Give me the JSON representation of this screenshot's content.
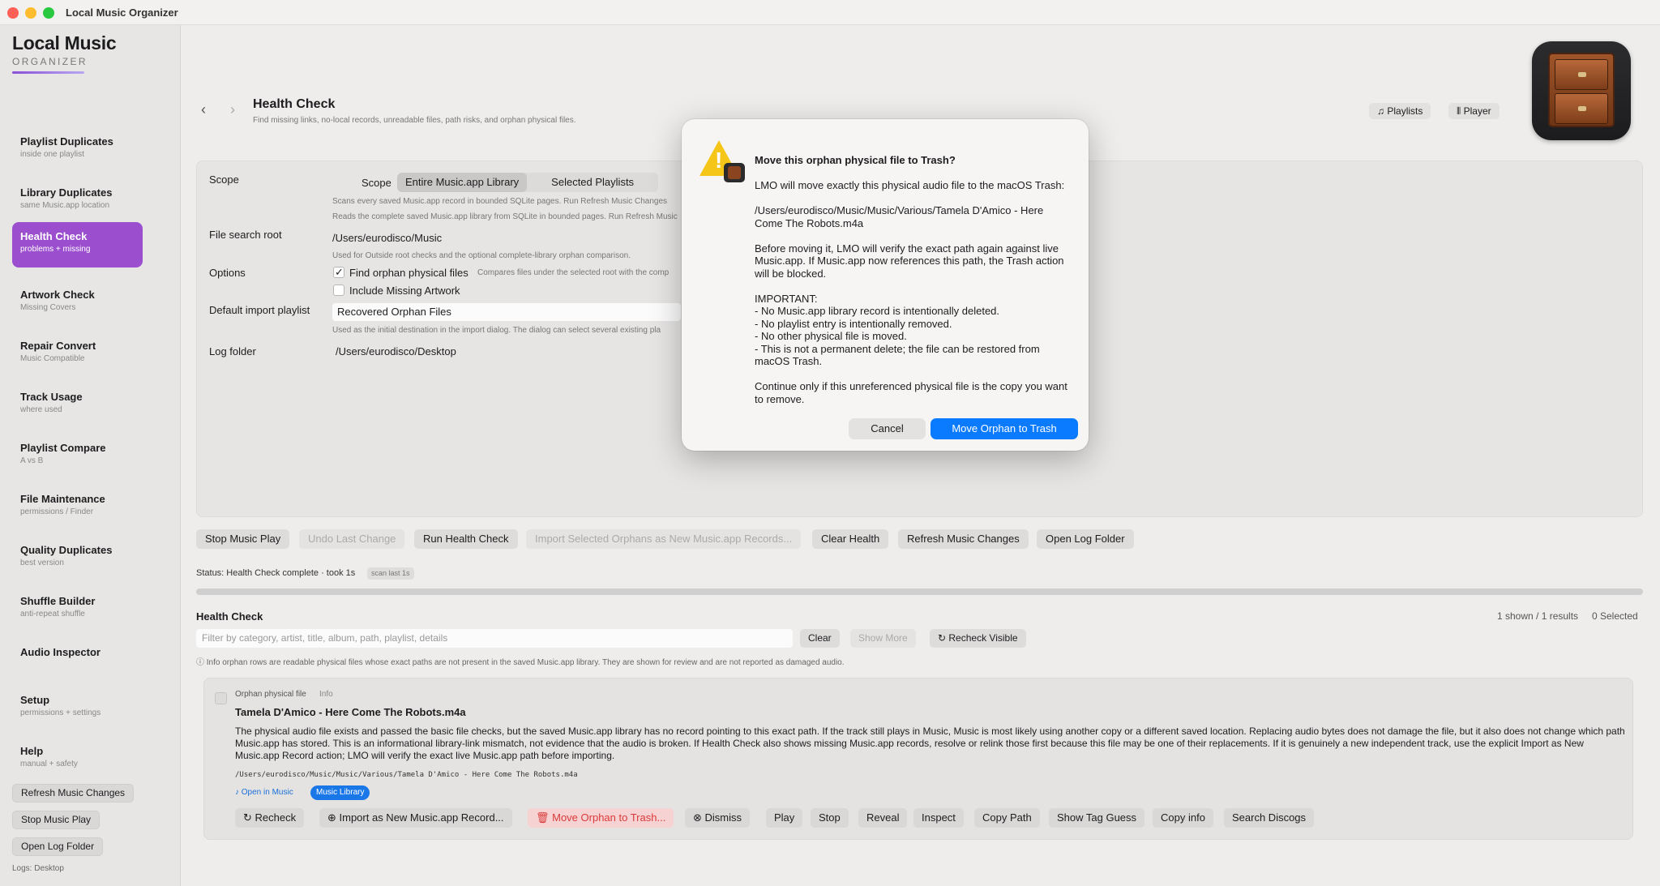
{
  "window": {
    "title": "Local Music Organizer"
  },
  "brand": {
    "title": "Local Music",
    "subtitle": "ORGANIZER"
  },
  "sidebar": {
    "items": [
      {
        "label": "Playlist Duplicates",
        "sub": "inside one playlist"
      },
      {
        "label": "Library Duplicates",
        "sub": "same Music.app location"
      },
      {
        "label": "Health Check",
        "sub": "problems + missing"
      },
      {
        "label": "Artwork Check",
        "sub": "Missing Covers"
      },
      {
        "label": "Repair Convert",
        "sub": "Music Compatible"
      },
      {
        "label": "Track Usage",
        "sub": "where used"
      },
      {
        "label": "Playlist Compare",
        "sub": "A vs B"
      },
      {
        "label": "File Maintenance",
        "sub": "permissions / Finder"
      },
      {
        "label": "Quality Duplicates",
        "sub": "best version"
      },
      {
        "label": "Shuffle Builder",
        "sub": "anti-repeat shuffle"
      },
      {
        "label": "Audio Inspector",
        "sub": ""
      },
      {
        "label": "Setup",
        "sub": "permissions + settings"
      },
      {
        "label": "Help",
        "sub": "manual + safety"
      }
    ],
    "buttons": [
      "Refresh Music Changes",
      "Stop Music Play",
      "Open Log Folder"
    ],
    "logs": "Logs: Desktop"
  },
  "header": {
    "title": "Health Check",
    "subtitle": "Find missing links, no-local records, unreadable files, path risks, and orphan physical files.",
    "playlists": "Playlists",
    "player": "Player"
  },
  "settings": {
    "scope_label": "Scope",
    "scope_inner": "Scope",
    "scope_options": [
      "Entire Music.app Library",
      "Selected Playlists"
    ],
    "scope_hint1": "Scans every saved Music.app record in bounded SQLite pages. Run Refresh Music Changes",
    "scope_hint2": "Reads the complete saved Music.app library from SQLite in bounded pages. Run Refresh Music",
    "root_label": "File search root",
    "root_value": "/Users/eurodisco/Music",
    "root_hint": "Used for Outside root checks and the optional complete-library orphan comparison.",
    "options_label": "Options",
    "opt_orphan": "Find orphan physical files",
    "opt_orphan_hint": "Compares files under the selected root with the comp",
    "opt_artwork": "Include Missing Artwork",
    "playlist_label": "Default import playlist",
    "playlist_value": "Recovered Orphan Files",
    "playlist_hint": "Used as the initial destination in the import dialog. The dialog can select several existing pla",
    "log_label": "Log folder",
    "log_value": "/Users/eurodisco/Desktop"
  },
  "actions": [
    "Stop Music Play",
    "Undo Last Change",
    "Run Health Check",
    "Import Selected Orphans as New Music.app Records...",
    "Clear Health",
    "Refresh Music Changes",
    "Open Log Folder"
  ],
  "status": {
    "text": "Status: Health Check complete · took 1s",
    "badge": "scan last 1s"
  },
  "results": {
    "title": "Health Check",
    "shown": "1 shown / 1 results",
    "selected": "0 Selected",
    "filter_placeholder": "Filter by category, artist, title, album, path, playlist, details",
    "clear": "Clear",
    "show_more": "Show More",
    "recheck_visible": "Recheck Visible",
    "info": "Info orphan rows are readable physical files whose exact paths are not present in the saved Music.app library. They are shown for review and are not reported as damaged audio."
  },
  "card": {
    "category": "Orphan physical file",
    "severity": "Info",
    "title": "Tamela D'Amico - Here Come The Robots.m4a",
    "description": "The physical audio file exists and passed the basic file checks, but the saved Music.app library has no record pointing to this exact path. If the track still plays in Music, Music is most likely using another copy or a different saved location. Replacing audio bytes does not damage the file, but it also does not change which path Music.app has stored. This is an informational library-link mismatch, not evidence that the audio is broken. If Health Check also shows missing Music.app records, resolve or relink those first because this file may be one of their replacements. If it is genuinely a new independent track, use the explicit Import as New Music.app Record action; LMO will verify the exact live Music.app path before importing.",
    "path": "/Users/eurodisco/Music/Music/Various/Tamela D'Amico - Here Come The Robots.m4a",
    "open_in_music": "Open in Music",
    "library_pill": "Music Library",
    "buttons": [
      "Recheck",
      "Import as New Music.app Record...",
      "Move Orphan to Trash...",
      "Dismiss",
      "Play",
      "Stop",
      "Reveal",
      "Inspect",
      "Copy Path",
      "Show Tag Guess",
      "Copy info",
      "Search Discogs"
    ]
  },
  "dialog": {
    "title": "Move this orphan physical file to Trash?",
    "body": "LMO will move exactly this physical audio file to the macOS Trash:\n\n/Users/eurodisco/Music/Music/Various/Tamela D'Amico - Here Come The Robots.m4a\n\nBefore moving it, LMO will verify the exact path again against live Music.app. If Music.app now references this path, the Trash action will be blocked.\n\nIMPORTANT:\n- No Music.app library record is intentionally deleted.\n- No playlist entry is intentionally removed.\n- No other physical file is moved.\n- This is not a permanent delete; the file can be restored from macOS Trash.\n\nContinue only if this unreferenced physical file is the copy you want to remove.",
    "cancel": "Cancel",
    "confirm": "Move Orphan to Trash"
  }
}
